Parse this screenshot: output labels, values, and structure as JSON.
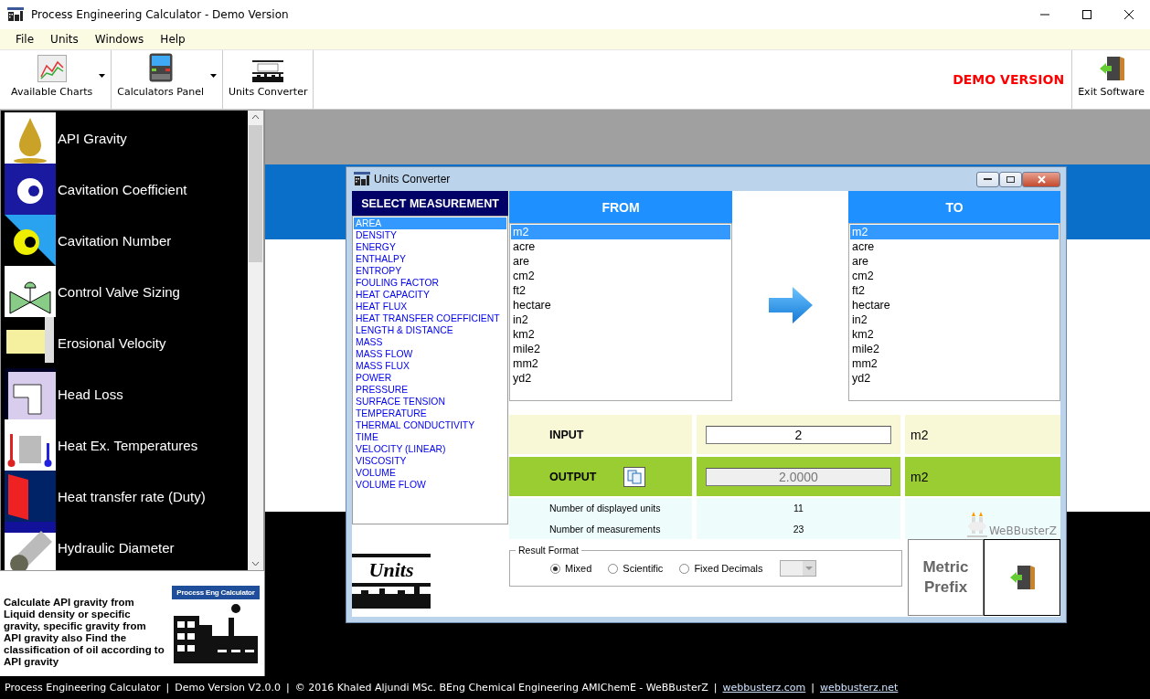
{
  "window": {
    "title": "Process Engineering Calculator - Demo Version"
  },
  "menu": [
    "File",
    "Units",
    "Windows",
    "Help"
  ],
  "toolbar": [
    {
      "label": "Available Charts",
      "kind": "charts",
      "dropdown": true
    },
    {
      "label": "Calculators Panel",
      "kind": "calculator",
      "dropdown": true
    },
    {
      "label": "Units Converter",
      "kind": "units",
      "dropdown": false
    }
  ],
  "demo_banner": "DEMO VERSION",
  "exit_button": "Exit Software",
  "sidebar": {
    "items": [
      {
        "label": "API Gravity",
        "kind": "drop"
      },
      {
        "label": "Cavitation Coefficient",
        "kind": "cav1"
      },
      {
        "label": "Cavitation Number",
        "kind": "cav2"
      },
      {
        "label": "Control Valve Sizing",
        "kind": "valve"
      },
      {
        "label": "Erosional Velocity",
        "kind": "pipe"
      },
      {
        "label": "Head Loss",
        "kind": "head"
      },
      {
        "label": "Heat Ex. Temperatures",
        "kind": "thermo"
      },
      {
        "label": "Heat transfer rate (Duty)",
        "kind": "duty"
      },
      {
        "label": "Hydraulic Diameter",
        "kind": "cylinder"
      }
    ],
    "description": "Calculate API gravity from Liquid density or specific gravity, specific gravity from API gravity also Find the classification of oil according to API gravity",
    "badge": "Process Eng Calculator"
  },
  "converter": {
    "title": "Units Converter",
    "measurement_header": "SELECT MEASUREMENT",
    "measurements": [
      {
        "label": "AREA",
        "selected": true
      },
      {
        "label": "DENSITY",
        "selected": false
      },
      {
        "label": "ENERGY",
        "selected": false
      },
      {
        "label": "ENTHALPY",
        "selected": false
      },
      {
        "label": "ENTROPY",
        "selected": false
      },
      {
        "label": "FOULING FACTOR",
        "selected": false
      },
      {
        "label": "HEAT CAPACITY",
        "selected": false
      },
      {
        "label": "HEAT FLUX",
        "selected": false
      },
      {
        "label": "HEAT TRANSFER COEFFICIENT",
        "selected": false
      },
      {
        "label": "LENGTH & DISTANCE",
        "selected": false
      },
      {
        "label": "MASS",
        "selected": false
      },
      {
        "label": "MASS FLOW",
        "selected": false
      },
      {
        "label": "MASS FLUX",
        "selected": false
      },
      {
        "label": "POWER",
        "selected": false
      },
      {
        "label": "PRESSURE",
        "selected": false
      },
      {
        "label": "SURFACE TENSION",
        "selected": false
      },
      {
        "label": "TEMPERATURE",
        "selected": false
      },
      {
        "label": "THERMAL CONDUCTIVITY",
        "selected": false
      },
      {
        "label": "TIME",
        "selected": false
      },
      {
        "label": "VELOCITY (LINEAR)",
        "selected": false
      },
      {
        "label": "VISCOSITY",
        "selected": false
      },
      {
        "label": "VOLUME",
        "selected": false
      },
      {
        "label": "VOLUME FLOW",
        "selected": false
      }
    ],
    "from_header": "FROM",
    "from_units": [
      {
        "label": "m2",
        "selected": true
      },
      {
        "label": "acre",
        "selected": false
      },
      {
        "label": "are",
        "selected": false
      },
      {
        "label": "cm2",
        "selected": false
      },
      {
        "label": "ft2",
        "selected": false
      },
      {
        "label": "hectare",
        "selected": false
      },
      {
        "label": "in2",
        "selected": false
      },
      {
        "label": "km2",
        "selected": false
      },
      {
        "label": "mile2",
        "selected": false
      },
      {
        "label": "mm2",
        "selected": false
      },
      {
        "label": "yd2",
        "selected": false
      }
    ],
    "to_header": "TO",
    "to_units": [
      {
        "label": "m2",
        "selected": true
      },
      {
        "label": "acre",
        "selected": false
      },
      {
        "label": "are",
        "selected": false
      },
      {
        "label": "cm2",
        "selected": false
      },
      {
        "label": "ft2",
        "selected": false
      },
      {
        "label": "hectare",
        "selected": false
      },
      {
        "label": "in2",
        "selected": false
      },
      {
        "label": "km2",
        "selected": false
      },
      {
        "label": "mile2",
        "selected": false
      },
      {
        "label": "mm2",
        "selected": false
      },
      {
        "label": "yd2",
        "selected": false
      }
    ],
    "input": {
      "label": "INPUT",
      "value": "2",
      "unit": "m2"
    },
    "output": {
      "label": "OUTPUT",
      "value": "2.0000",
      "unit": "m2"
    },
    "stats": [
      {
        "label": "Number of displayed units",
        "value": "11"
      },
      {
        "label": "Number of measurements",
        "value": "23"
      }
    ],
    "logo_text": "WeBBusterZ",
    "units_logo": "Units",
    "result_format": {
      "legend": "Result Format",
      "options": [
        {
          "label": "Mixed",
          "selected": true
        },
        {
          "label": "Scientific",
          "selected": false
        },
        {
          "label": "Fixed Decimals",
          "selected": false
        }
      ]
    },
    "metric_prefix_button": "Metric Prefix"
  },
  "status_bar": [
    {
      "text": "Process Engineering Calculator",
      "kind": "text"
    },
    {
      "text": "|",
      "kind": "separator"
    },
    {
      "text": "Demo Version V2.0.0",
      "kind": "text"
    },
    {
      "text": "|",
      "kind": "separator"
    },
    {
      "text": "© 2016 Khaled Aljundi MSc. BEng Chemical Engineering AMIChemE - WeBBusterZ",
      "kind": "text"
    },
    {
      "text": "|",
      "kind": "separator"
    },
    {
      "text": "webbusterz.com",
      "kind": "link"
    },
    {
      "text": "|",
      "kind": "separator"
    },
    {
      "text": "webbusterz.net",
      "kind": "link"
    }
  ]
}
